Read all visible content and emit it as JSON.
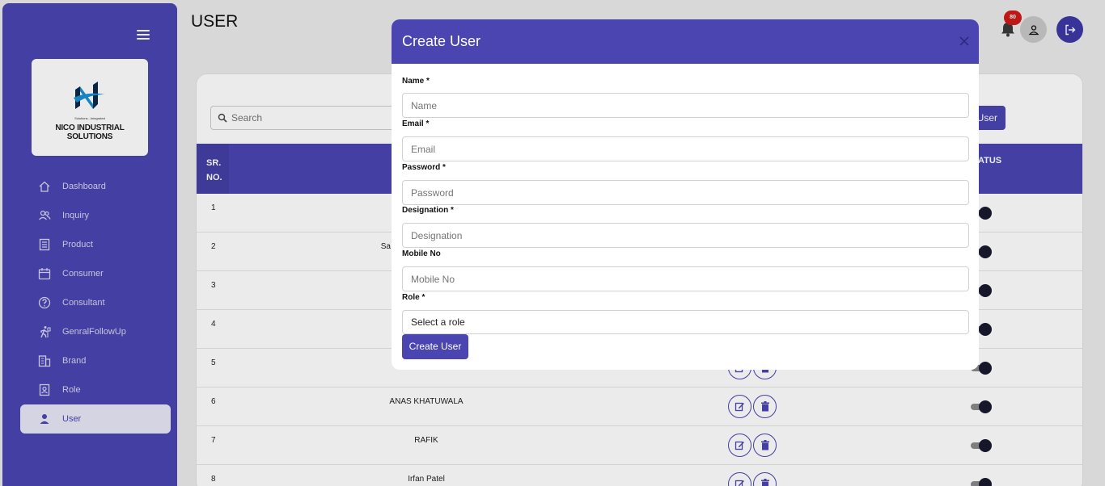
{
  "sidebar": {
    "logo": {
      "tagline": "Solutions...Integrated",
      "name": "NICO INDUSTRIAL SOLUTIONS"
    },
    "items": [
      {
        "label": "Dashboard",
        "icon": "home-icon"
      },
      {
        "label": "Inquiry",
        "icon": "users-icon"
      },
      {
        "label": "Product",
        "icon": "document-icon"
      },
      {
        "label": "Consumer",
        "icon": "calendar-icon"
      },
      {
        "label": "Consultant",
        "icon": "help-circle-icon"
      },
      {
        "label": "GenralFollowUp",
        "icon": "person-walking-icon"
      },
      {
        "label": "Brand",
        "icon": "building-icon"
      },
      {
        "label": "Role",
        "icon": "id-badge-icon"
      },
      {
        "label": "User",
        "icon": "user-icon",
        "active": true
      }
    ]
  },
  "header": {
    "title": "USER",
    "notification_count": "80"
  },
  "table": {
    "search_placeholder": "Search",
    "add_button_label": "User",
    "columns": {
      "sr": "SR. NO.",
      "status": "ATUS"
    },
    "rows": [
      {
        "sr": "1",
        "name": ""
      },
      {
        "sr": "2",
        "name": "Sa"
      },
      {
        "sr": "3",
        "name": ""
      },
      {
        "sr": "4",
        "name": ""
      },
      {
        "sr": "5",
        "name": ""
      },
      {
        "sr": "6",
        "name": "ANAS KHATUWALA"
      },
      {
        "sr": "7",
        "name": "RAFIK"
      },
      {
        "sr": "8",
        "name": "Irfan Patel"
      }
    ]
  },
  "modal": {
    "title": "Create User",
    "fields": {
      "name": {
        "label": "Name *",
        "placeholder": "Name"
      },
      "email": {
        "label": "Email *",
        "placeholder": "Email"
      },
      "password": {
        "label": "Password *",
        "placeholder": "Password"
      },
      "designation": {
        "label": "Designation *",
        "placeholder": "Designation"
      },
      "mobile": {
        "label": "Mobile No",
        "placeholder": "Mobile No"
      },
      "role": {
        "label": "Role *",
        "value": "Select a role"
      }
    },
    "submit_label": "Create User"
  },
  "colors": {
    "primary": "#4a45b0",
    "badge": "#d01818"
  }
}
